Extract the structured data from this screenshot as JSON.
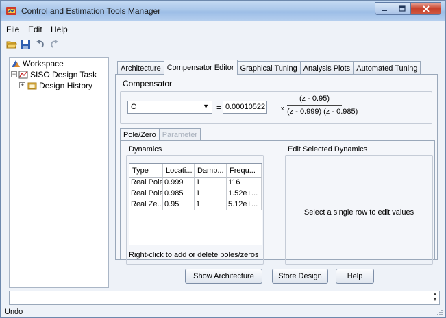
{
  "window": {
    "title": "Control and Estimation Tools Manager"
  },
  "menu": {
    "items": [
      "File",
      "Edit",
      "Help"
    ]
  },
  "toolbar": {
    "icons": [
      "open-folder-icon",
      "save-icon",
      "undo-icon",
      "redo-icon"
    ]
  },
  "tree": {
    "root": "Workspace",
    "task": "SISO Design Task",
    "child": "Design History"
  },
  "tabs": [
    "Architecture",
    "Compensator Editor",
    "Graphical Tuning",
    "Analysis Plots",
    "Automated Tuning"
  ],
  "active_tab": "Compensator Editor",
  "compensator": {
    "section_title": "Compensator",
    "selected": "C",
    "equals": "=",
    "gain": "0.00010522",
    "times": "x",
    "numerator": "(z - 0.95)",
    "denominator": "(z - 0.999) (z - 0.985)"
  },
  "subtabs": [
    "Pole/Zero",
    "Parameter"
  ],
  "dynamics": {
    "title": "Dynamics",
    "columns": [
      "Type",
      "Locati...",
      "Damp...",
      "Frequ..."
    ],
    "rows": [
      [
        "Real Pole",
        "0.999",
        "1",
        "116"
      ],
      [
        "Real Pole",
        "0.985",
        "1",
        "1.52e+..."
      ],
      [
        "Real Ze...",
        "0.95",
        "1",
        "5.12e+..."
      ]
    ],
    "hint": "Right-click to add or delete poles/zeros"
  },
  "edit_dynamics": {
    "title": "Edit Selected Dynamics",
    "message": "Select a single row to edit values"
  },
  "buttons": {
    "show_architecture": "Show Architecture",
    "store_design": "Store Design",
    "help": "Help"
  },
  "status": {
    "text": "Undo"
  },
  "colors": {
    "window_bg": "#eef2f8",
    "titlebar": "#a9c6ea",
    "close_button": "#c7412b",
    "tree_selected": "#c0c0c0"
  }
}
